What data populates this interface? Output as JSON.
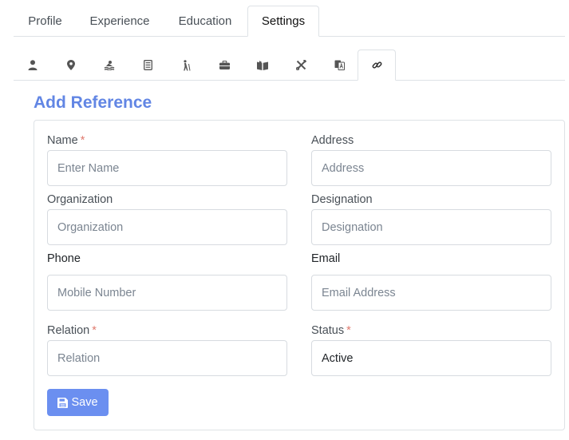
{
  "top_tabs": [
    {
      "label": "Profile"
    },
    {
      "label": "Experience"
    },
    {
      "label": "Education"
    },
    {
      "label": "Settings"
    }
  ],
  "active_top_tab": "Settings",
  "icon_tabs": [
    {
      "icon": "user-icon"
    },
    {
      "icon": "map-marker-icon"
    },
    {
      "icon": "swimmer-icon"
    },
    {
      "icon": "list-document-icon"
    },
    {
      "icon": "hiking-icon"
    },
    {
      "icon": "briefcase-icon"
    },
    {
      "icon": "book-open-icon"
    },
    {
      "icon": "tools-icon"
    },
    {
      "icon": "language-icon"
    },
    {
      "icon": "link-icon"
    }
  ],
  "active_icon_tab": "link-icon",
  "form": {
    "title": "Add Reference",
    "name": {
      "label": "Name",
      "required": "*",
      "placeholder": "Enter Name",
      "value": ""
    },
    "address": {
      "label": "Address",
      "placeholder": "Address",
      "value": ""
    },
    "organization": {
      "label": "Organization",
      "placeholder": "Organization",
      "value": ""
    },
    "designation": {
      "label": "Designation",
      "placeholder": "Designation",
      "value": ""
    },
    "phone": {
      "label": "Phone",
      "placeholder": "Mobile Number",
      "value": ""
    },
    "email": {
      "label": "Email",
      "placeholder": "Email Address",
      "value": ""
    },
    "relation": {
      "label": "Relation",
      "required": "*",
      "placeholder": "Relation",
      "value": ""
    },
    "status": {
      "label": "Status",
      "required": "*",
      "selected": "Active"
    },
    "save_label": "Save"
  },
  "colors": {
    "accent": "#6286e4",
    "button": "#6b8ff0",
    "required": "#e07b6f",
    "border": "#dee2e6"
  }
}
